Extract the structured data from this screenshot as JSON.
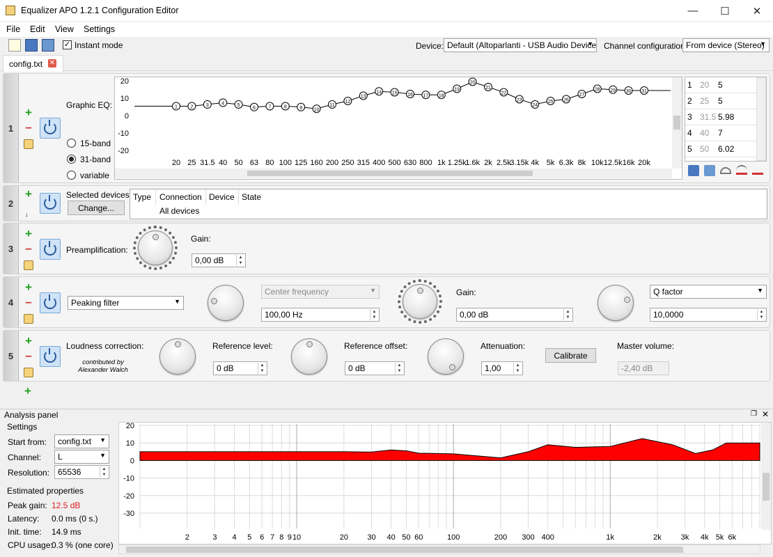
{
  "window": {
    "title": "Equalizer APO 1.2.1 Configuration Editor"
  },
  "menu": [
    "File",
    "Edit",
    "View",
    "Settings"
  ],
  "toolbar": {
    "instant_mode_label": "Instant mode",
    "instant_mode_checked": true,
    "device_label": "Device:",
    "device_value": "Default (Altoparlanti - USB Audio Device)",
    "channel_label": "Channel configuration:",
    "channel_value": "From device (Stereo)"
  },
  "tab": {
    "label": "config.txt"
  },
  "panel1": {
    "number": "1",
    "label": "Graphic EQ:",
    "radios": [
      {
        "label": "15-band",
        "checked": false
      },
      {
        "label": "31-band",
        "checked": true
      },
      {
        "label": "variable",
        "checked": false
      }
    ],
    "y_ticks": [
      "20",
      "10",
      "0",
      "-10",
      "-20"
    ],
    "freq_labels": [
      "20",
      "25",
      "31.5",
      "40",
      "50",
      "63",
      "80",
      "100",
      "125",
      "160",
      "200",
      "250",
      "315",
      "400",
      "500",
      "630",
      "800",
      "1k",
      "1.25k",
      "1.6k",
      "2k",
      "2.5k",
      "3.15k",
      "4k",
      "5k",
      "6.3k",
      "8k",
      "10k",
      "12.5k",
      "16k",
      "20k"
    ],
    "band_gains": [
      5,
      5,
      5.98,
      7,
      6.02,
      4.5,
      5,
      5,
      4.5,
      3.5,
      6,
      8,
      11,
      13.5,
      13,
      12,
      11.5,
      11.5,
      15,
      19,
      16,
      13,
      9,
      6,
      8,
      9,
      12,
      15,
      14.5,
      14,
      14
    ],
    "table": [
      [
        "1",
        "20",
        "5"
      ],
      [
        "2",
        "25",
        "5"
      ],
      [
        "3",
        "31.5",
        "5.98"
      ],
      [
        "4",
        "40",
        "7"
      ],
      [
        "5",
        "50",
        "6.02"
      ]
    ]
  },
  "panel2": {
    "number": "2",
    "label": "Selected devices:",
    "change_button": "Change...",
    "columns": [
      "Type",
      "Connection",
      "Device",
      "State"
    ],
    "row": "All devices"
  },
  "panel3": {
    "number": "3",
    "label": "Preamplification:",
    "gain_label": "Gain:",
    "gain_value": "0,00 dB"
  },
  "panel4": {
    "number": "4",
    "filter_type": "Peaking filter",
    "freq_combo": "Center frequency",
    "freq_value": "100,00 Hz",
    "gain_label": "Gain:",
    "gain_value": "0,00 dB",
    "q_combo": "Q factor",
    "q_value": "10,0000"
  },
  "panel5": {
    "number": "5",
    "label": "Loudness correction:",
    "credit": "contributed by Alexander Walch",
    "ref_level_label": "Reference level:",
    "ref_level_value": "0 dB",
    "ref_offset_label": "Reference offset:",
    "ref_offset_value": "0 dB",
    "atten_label": "Attenuation:",
    "atten_value": "1,00",
    "calibrate": "Calibrate",
    "master_label": "Master volume:",
    "master_value": "-2,40 dB"
  },
  "analysis": {
    "title": "Analysis panel",
    "settings_label": "Settings",
    "start_from_label": "Start from:",
    "start_from_value": "config.txt",
    "channel_label": "Channel:",
    "channel_value": "L",
    "resolution_label": "Resolution:",
    "resolution_value": "65536",
    "est_label": "Estimated properties",
    "peak_gain_label": "Peak gain:",
    "peak_gain_value": "12.5 dB",
    "latency_label": "Latency:",
    "latency_value": "0.0 ms (0 s.)",
    "init_label": "Init. time:",
    "init_value": "14.9 ms",
    "cpu_label": "CPU usage:",
    "cpu_value": "0.3 % (one core)",
    "y_ticks": [
      "20",
      "10",
      "0",
      "-10",
      "-20",
      "-30"
    ],
    "x_ticks": [
      "2",
      "3",
      "4",
      "5",
      "6",
      "7",
      "8",
      "9",
      "10",
      "20",
      "30",
      "40",
      "50",
      "60",
      "100",
      "200",
      "300",
      "400",
      "1k",
      "2k",
      "3k",
      "4k",
      "5k",
      "6k"
    ],
    "accent_color": "#ff0000"
  }
}
